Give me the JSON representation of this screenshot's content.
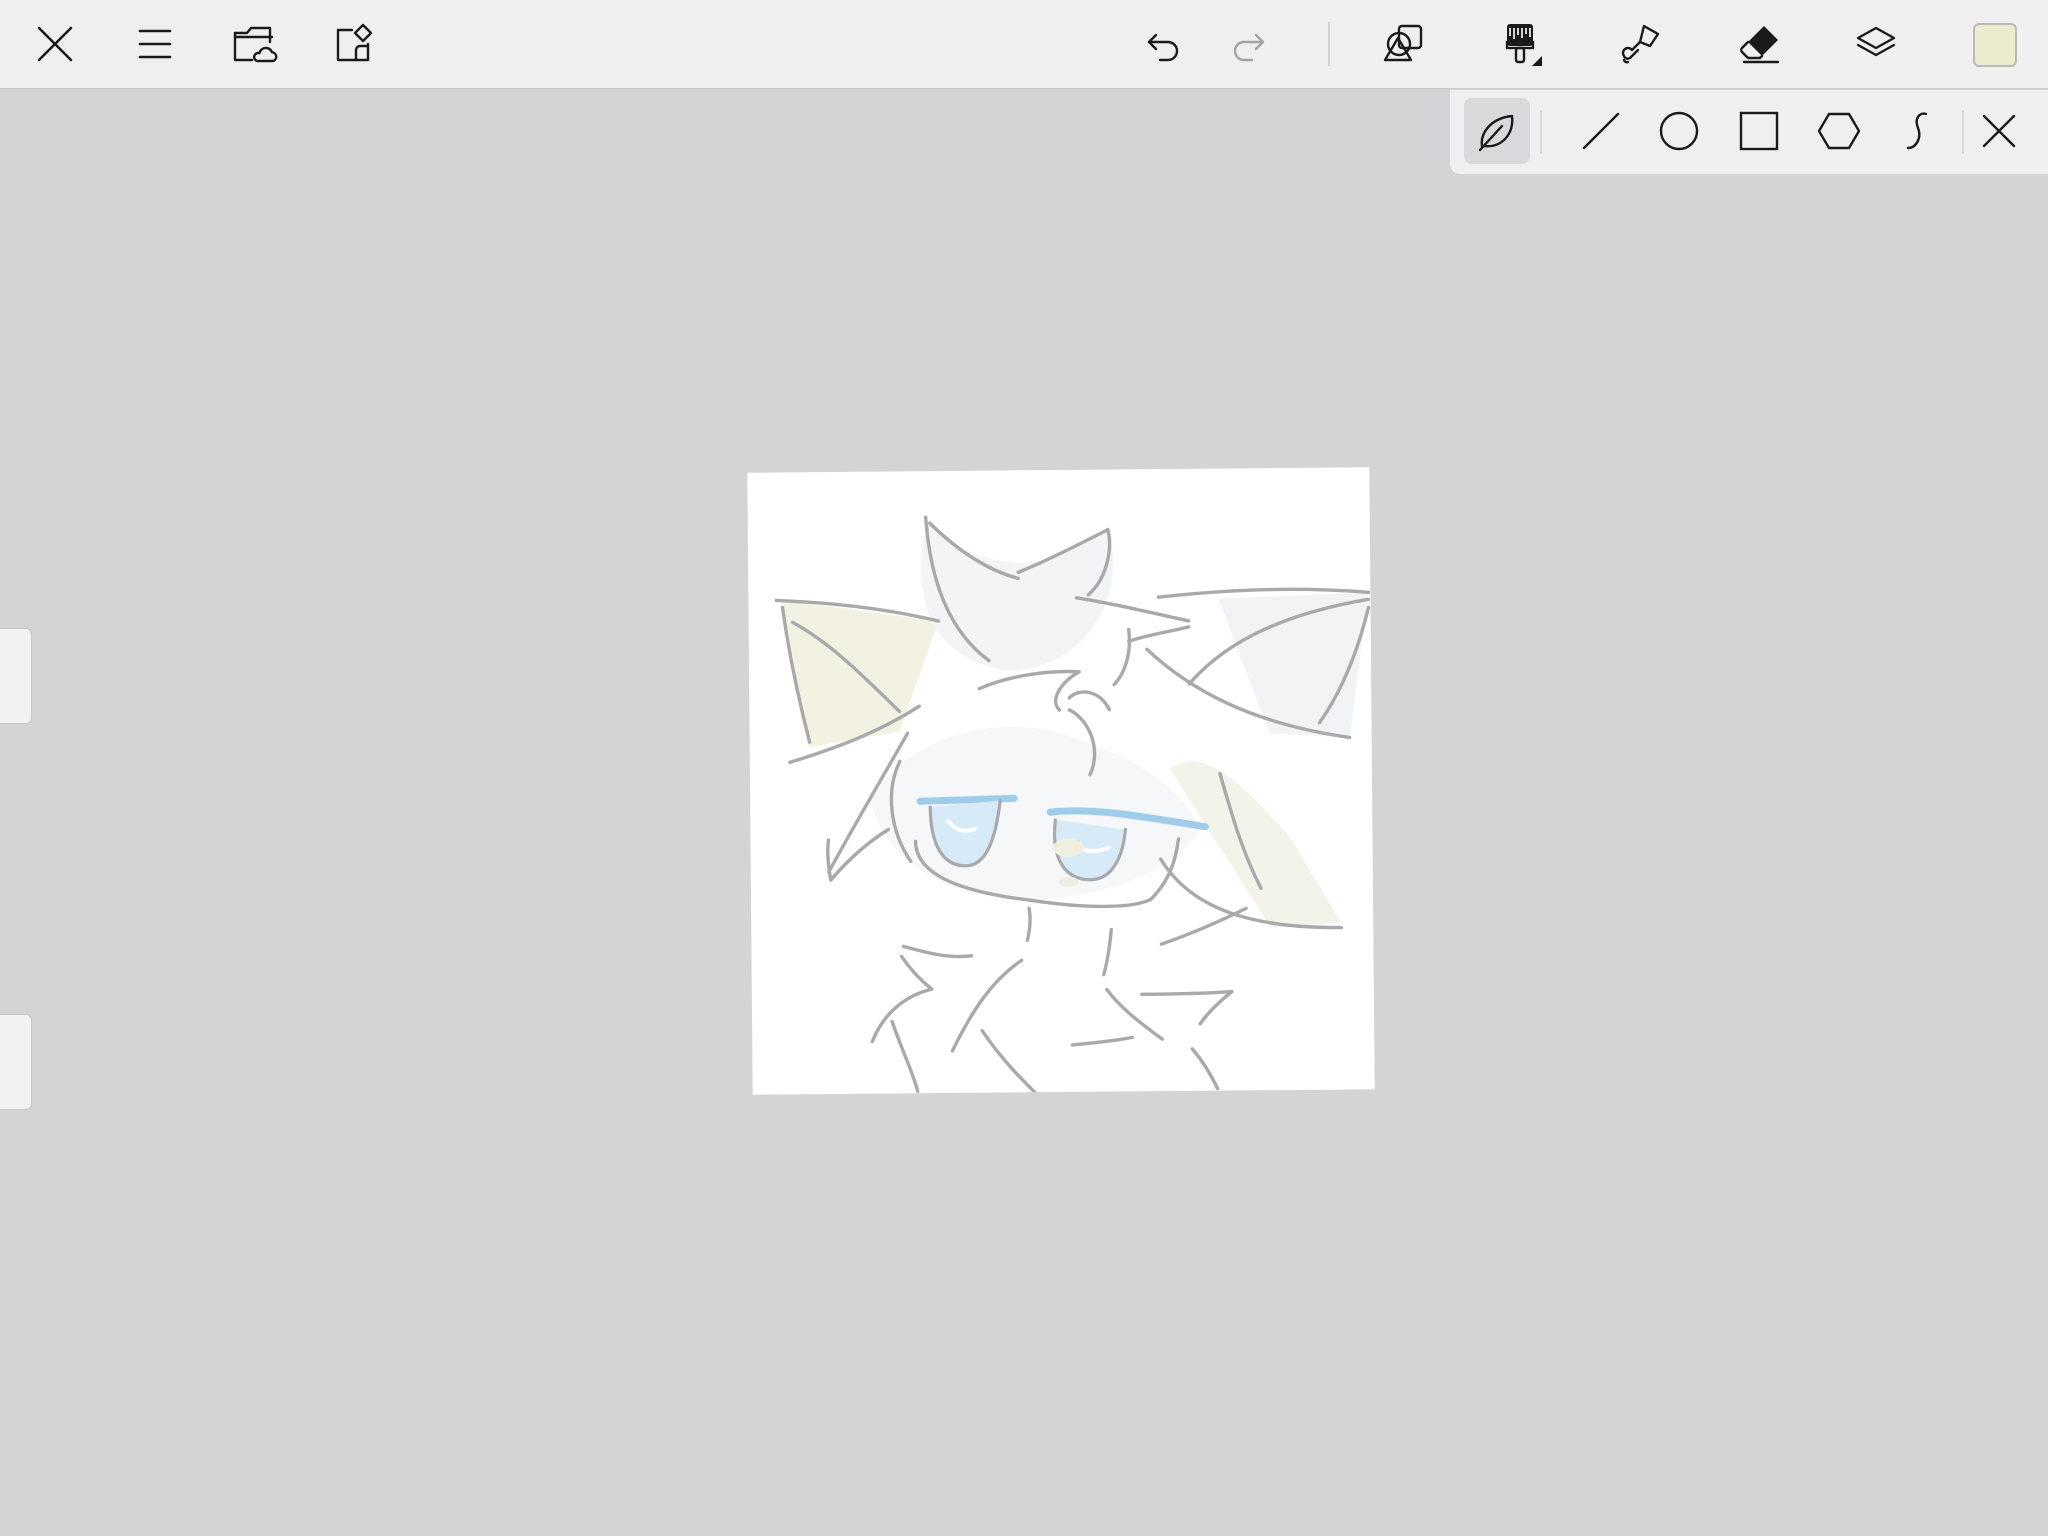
{
  "toolbar": {
    "left": [
      {
        "name": "close-button",
        "icon": "close-icon"
      },
      {
        "name": "menu-button",
        "icon": "hamburger-menu-icon"
      },
      {
        "name": "cloud-folder-button",
        "icon": "cloud-folder-icon"
      },
      {
        "name": "import-button",
        "icon": "shape-import-icon"
      }
    ],
    "right": [
      {
        "name": "undo-button",
        "icon": "undo-icon"
      },
      {
        "name": "redo-button",
        "icon": "redo-icon",
        "disabled": true
      },
      {
        "name": "shapes-tool-button",
        "icon": "shapes-icon"
      },
      {
        "name": "brush-tool-button",
        "icon": "brush-icon"
      },
      {
        "name": "smudge-tool-button",
        "icon": "smudge-icon"
      },
      {
        "name": "eraser-tool-button",
        "icon": "eraser-icon"
      },
      {
        "name": "layers-button",
        "icon": "layers-icon"
      }
    ],
    "current_color": "#ecebcd"
  },
  "shape_panel": {
    "tools": [
      {
        "name": "freehand-shape-button",
        "icon": "leaf-icon",
        "active": true
      },
      {
        "name": "line-shape-button",
        "icon": "line-icon"
      },
      {
        "name": "ellipse-shape-button",
        "icon": "circle-icon"
      },
      {
        "name": "rectangle-shape-button",
        "icon": "square-icon"
      },
      {
        "name": "polygon-shape-button",
        "icon": "hexagon-icon"
      },
      {
        "name": "curve-shape-button",
        "icon": "curve-icon"
      },
      {
        "name": "close-panel-button",
        "icon": "close-icon"
      }
    ]
  },
  "colors": {
    "background": "#d4d4d6",
    "toolbar": "#efefef",
    "canvas": "#ffffff",
    "line_art": "#a9a9ab",
    "eye_blue": "#a9d3ef",
    "ear_cream": "#ecebd6"
  }
}
